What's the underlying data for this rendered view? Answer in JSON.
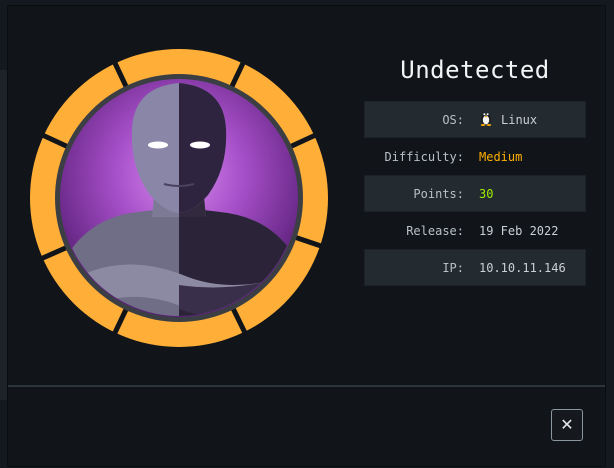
{
  "machine": {
    "name": "Undetected",
    "avatar_icon": "machine-avatar-icon"
  },
  "info": {
    "os": {
      "label": "OS:",
      "value": "Linux",
      "icon": "tux-icon"
    },
    "difficulty": {
      "label": "Difficulty:",
      "value": "Medium",
      "color": "#ffaf00"
    },
    "points": {
      "label": "Points:",
      "value": "30",
      "color": "#9fef00"
    },
    "release": {
      "label": "Release:",
      "value": "19 Feb 2022"
    },
    "ip": {
      "label": "IP:",
      "value": "10.10.11.146"
    }
  },
  "dialog": {
    "close_label": "✕"
  },
  "colors": {
    "ring": "#ffaf38",
    "modal_bg": "#111519",
    "row_shaded": "#232a30"
  }
}
